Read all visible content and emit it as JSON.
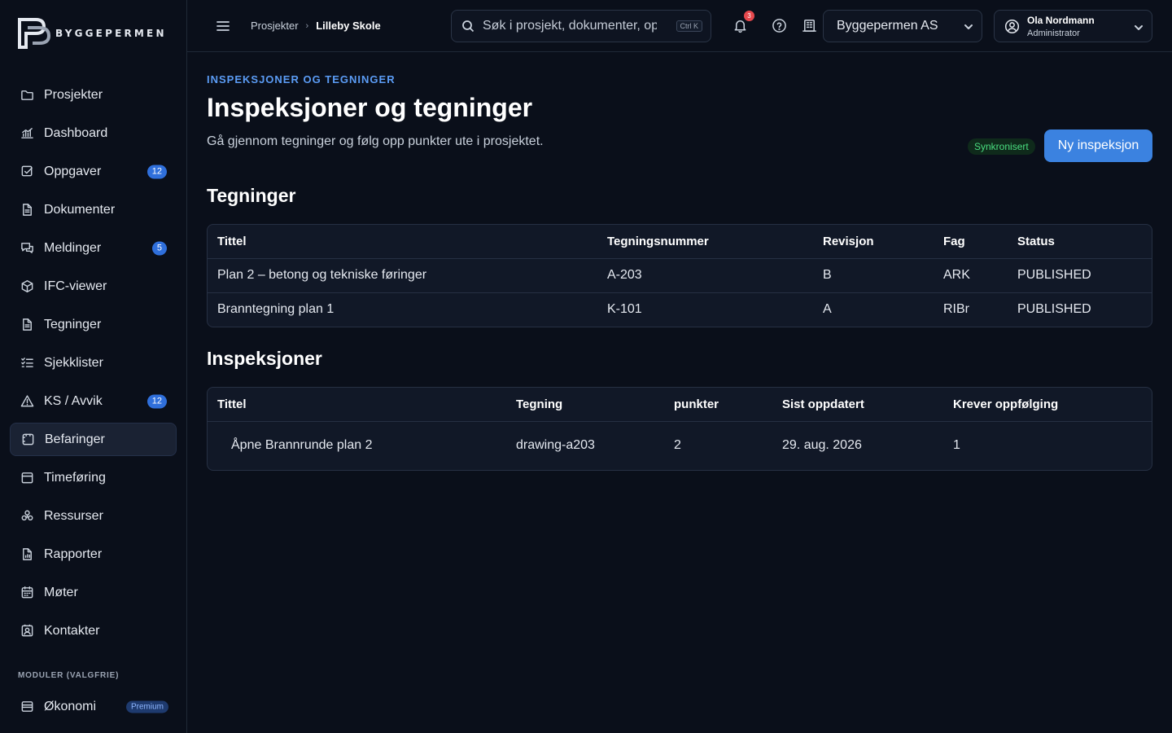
{
  "brand": {
    "name": "BYGGEPERMEN"
  },
  "sidebar": {
    "items": [
      {
        "label": "Prosjekter",
        "icon": "folder-icon"
      },
      {
        "label": "Dashboard",
        "icon": "chart-icon"
      },
      {
        "label": "Oppgaver",
        "icon": "checkbox-icon",
        "badge": "12"
      },
      {
        "label": "Dokumenter",
        "icon": "document-icon"
      },
      {
        "label": "Meldinger",
        "icon": "messages-icon",
        "badge": "5"
      },
      {
        "label": "IFC-viewer",
        "icon": "cube-icon"
      },
      {
        "label": "Tegninger",
        "icon": "document-icon"
      },
      {
        "label": "Sjekklister",
        "icon": "checklist-icon"
      },
      {
        "label": "KS / Avvik",
        "icon": "warning-icon",
        "badge": "12"
      },
      {
        "label": "Befaringer",
        "icon": "inspection-icon",
        "active": true
      },
      {
        "label": "Timeføring",
        "icon": "calendar-icon"
      },
      {
        "label": "Ressurser",
        "icon": "resources-icon"
      },
      {
        "label": "Rapporter",
        "icon": "report-icon"
      },
      {
        "label": "Møter",
        "icon": "meeting-icon"
      },
      {
        "label": "Kontakter",
        "icon": "contacts-icon"
      }
    ],
    "modules_title": "MODULER (VALGFRIE)",
    "modules": [
      {
        "label": "Økonomi",
        "icon": "economy-icon",
        "tag": "Premium"
      }
    ]
  },
  "header": {
    "breadcrumb": [
      "Prosjekter",
      "Lilleby Skole"
    ],
    "search_placeholder": "Søk i prosjekt, dokumenter, oppgaver",
    "search_shortcut": "Ctrl K",
    "notifications_count": "3",
    "company": "Byggepermen AS",
    "user": {
      "name": "Ola Nordmann",
      "role": "Administrator"
    }
  },
  "page": {
    "eyebrow": "INSPEKSJONER OG TEGNINGER",
    "title": "Inspeksjoner og tegninger",
    "subtitle": "Gå gjennom tegninger og følg opp punkter ute i prosjektet.",
    "sync_status": "Synkronisert",
    "new_button": "Ny inspeksjon"
  },
  "drawings": {
    "title": "Tegninger",
    "columns": [
      "Tittel",
      "Tegningsnummer",
      "Revisjon",
      "Fag",
      "Status"
    ],
    "rows": [
      [
        "Plan 2 – betong og tekniske føringer",
        "A-203",
        "B",
        "ARK",
        "PUBLISHED"
      ],
      [
        "Branntegning plan 1",
        "K-101",
        "A",
        "RIBr",
        "PUBLISHED"
      ]
    ]
  },
  "inspections": {
    "title": "Inspeksjoner",
    "columns": [
      "Tittel",
      "Tegning",
      "punkter",
      "Sist oppdatert",
      "Krever oppfølging"
    ],
    "rows": [
      [
        "Åpne Brannrunde plan 2",
        "drawing-a203",
        "2",
        "29. aug. 2026",
        "1"
      ]
    ]
  },
  "colors": {
    "accent": "#3b82e0",
    "eyebrow": "#5b9cf5",
    "success": "#4ade80",
    "background": "#0a0f1a"
  }
}
